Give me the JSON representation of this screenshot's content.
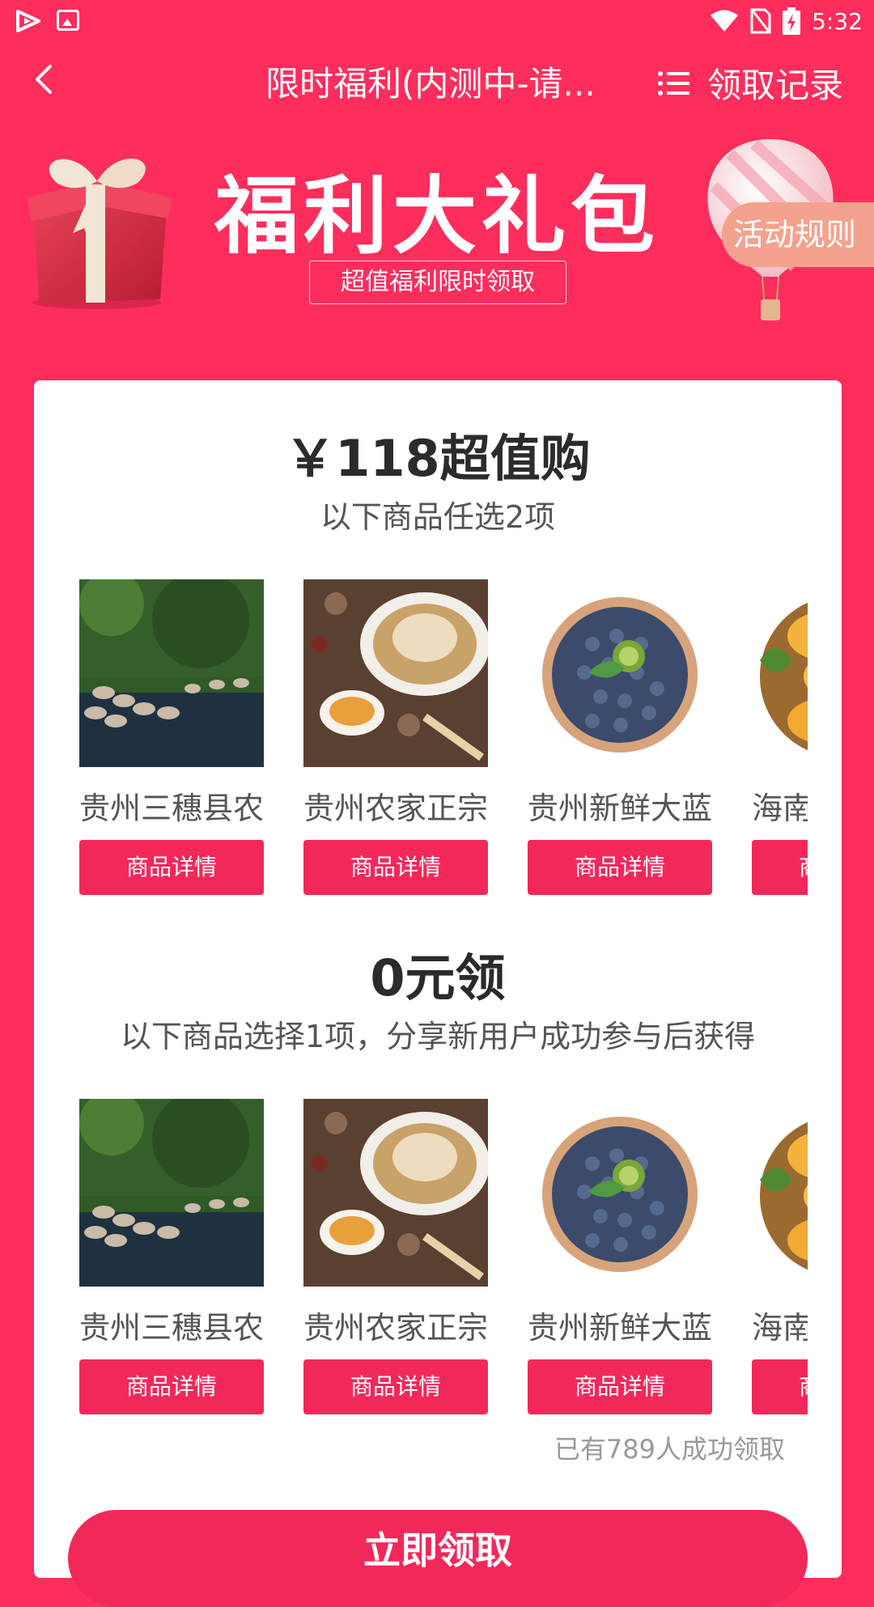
{
  "status_bar": {
    "time": "5:32",
    "icons": [
      "app-play-icon",
      "gallery-icon",
      "wifi-icon",
      "no-sim-icon",
      "battery-charging-icon"
    ]
  },
  "nav": {
    "back_icon": "chevron-left-icon",
    "title": "限时福利(内测中-请...",
    "records_icon": "list-icon",
    "records_label": "领取记录"
  },
  "banner": {
    "title": "福利大礼包",
    "subtitle": "超值福利限时领取",
    "rules_label": "活动规则"
  },
  "sections": [
    {
      "title": "￥118超值购",
      "subtitle": "以下商品任选2项",
      "items": [
        {
          "name": "贵州三穗县农",
          "button": "商品详情",
          "image": "geese-river"
        },
        {
          "name": "贵州农家正宗",
          "button": "商品详情",
          "image": "chicken-soup"
        },
        {
          "name": "贵州新鲜大蓝",
          "button": "商品详情",
          "image": "blueberries"
        },
        {
          "name": "海南",
          "button": "商品详情",
          "image": "mango-basket"
        }
      ]
    },
    {
      "title": "0元领",
      "subtitle": "以下商品选择1项，分享新用户成功参与后获得",
      "items": [
        {
          "name": "贵州三穗县农",
          "button": "商品详情",
          "image": "geese-river"
        },
        {
          "name": "贵州农家正宗",
          "button": "商品详情",
          "image": "chicken-soup"
        },
        {
          "name": "贵州新鲜大蓝",
          "button": "商品详情",
          "image": "blueberries"
        },
        {
          "name": "海南",
          "button": "商品详情",
          "image": "mango-basket"
        }
      ]
    }
  ],
  "claimed_text": "已有789人成功领取",
  "claim_button": "立即领取",
  "colors": {
    "background": "#FF2D5C",
    "button": "#F3285A",
    "rules_badge": "#F4A28D"
  }
}
